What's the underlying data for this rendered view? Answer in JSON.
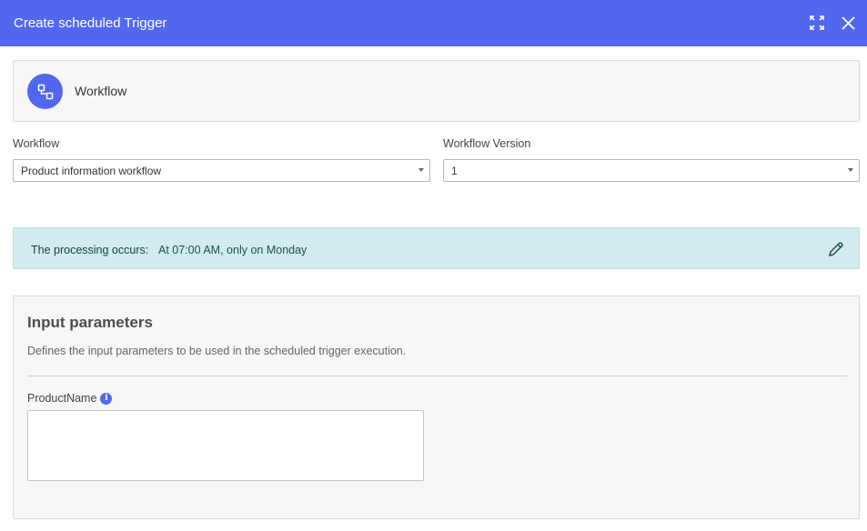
{
  "dialog": {
    "title": "Create scheduled Trigger",
    "expand_icon": "expand-icon",
    "close_icon": "close-icon"
  },
  "workflow_card": {
    "icon": "workflow-icon",
    "title": "Workflow"
  },
  "fields": {
    "workflow": {
      "label": "Workflow",
      "value": "Product information workflow"
    },
    "version": {
      "label": "Workflow Version",
      "value": "1"
    }
  },
  "schedule": {
    "label": "The processing occurs:",
    "value": "At 07:00 AM, only on Monday",
    "edit_icon": "pencil-icon"
  },
  "input_parameters": {
    "title": "Input parameters",
    "description": "Defines the input parameters to be used in the scheduled trigger execution.",
    "params": [
      {
        "label": "ProductName",
        "value": ""
      }
    ]
  },
  "colors": {
    "accent": "#5267f0",
    "info_bg": "#d1ebee"
  }
}
